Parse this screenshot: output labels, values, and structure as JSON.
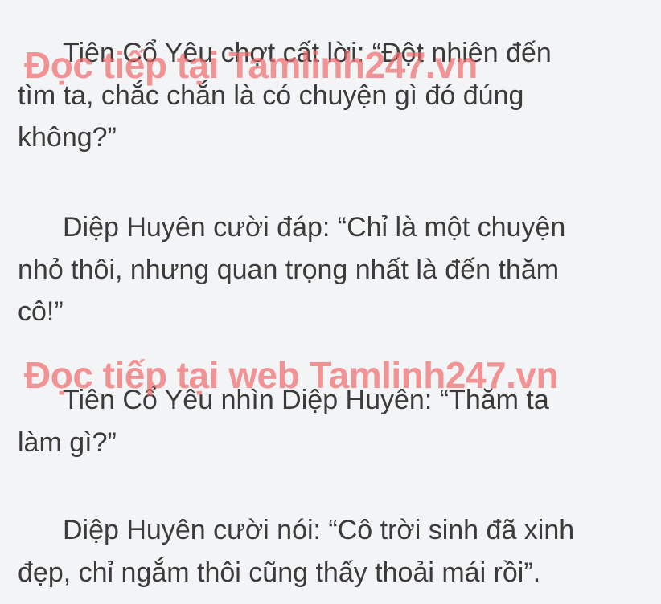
{
  "paragraphs": [
    {
      "lines": [
        "Tiên Cổ Yêu chợt cất lời: “Đột nhiên đến",
        "tìm ta, chắc chắn là có chuyện gì đó đúng",
        "không?”"
      ]
    },
    {
      "lines": [
        "Diệp Huyên cười đáp: “Chỉ là một chuyện",
        "nhỏ thôi, nhưng quan trọng nhất là đến thăm",
        "cô!”"
      ]
    },
    {
      "lines": [
        "Tiên Cổ Yêu nhìn Diệp Huyên: “Thăm ta",
        "làm gì?”"
      ]
    },
    {
      "lines": [
        "Diệp Huyên cười nói: “Cô trời sinh đã xinh",
        "đẹp, chỉ ngắm thôi cũng thấy thoải mái rồi”."
      ]
    }
  ],
  "watermarks": [
    "Đọc tiếp tại Tamlinh247.vn",
    "Đọc tiếp tại web Tamlinh247.vn"
  ],
  "colors": {
    "background": "#f3f4f6",
    "text": "#3b3b3b",
    "watermark": "#f06e6e"
  }
}
